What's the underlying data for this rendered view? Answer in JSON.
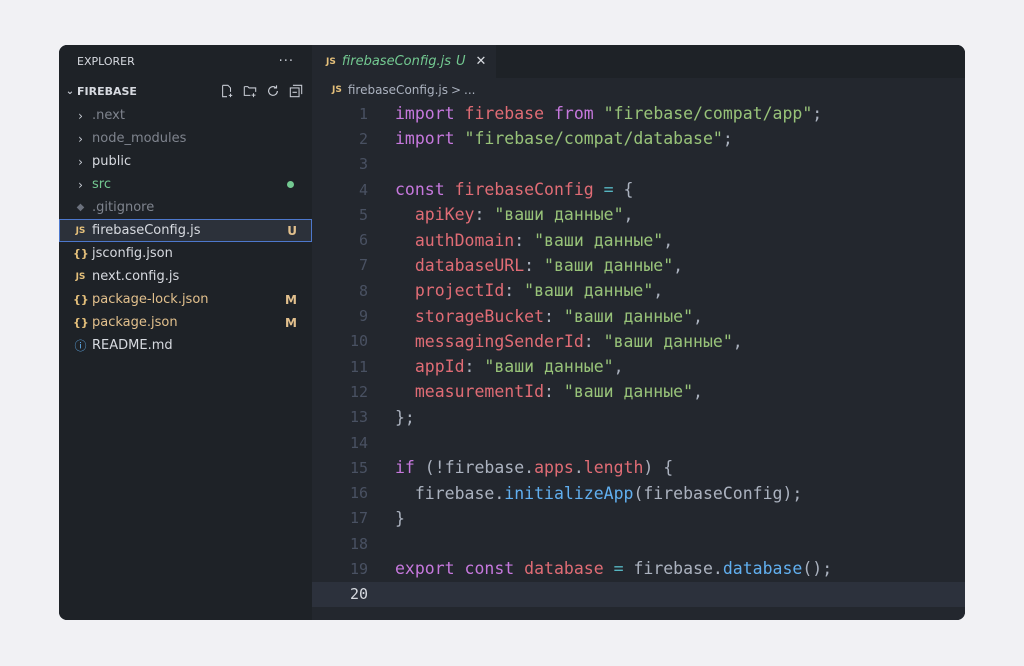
{
  "explorer": {
    "title": "EXPLORER",
    "more": "···",
    "folder": "FIREBASE",
    "items": [
      {
        "label": ".next",
        "kind": "folder",
        "style": "dim"
      },
      {
        "label": "node_modules",
        "kind": "folder",
        "style": "dim"
      },
      {
        "label": "public",
        "kind": "folder",
        "style": "normal"
      },
      {
        "label": "src",
        "kind": "folder",
        "style": "green"
      },
      {
        "label": ".gitignore",
        "kind": "git",
        "style": "dim"
      },
      {
        "label": "firebaseConfig.js",
        "kind": "js",
        "style": "normal",
        "badge": "U"
      },
      {
        "label": "jsconfig.json",
        "kind": "json",
        "style": "normal"
      },
      {
        "label": "next.config.js",
        "kind": "js",
        "style": "normal"
      },
      {
        "label": "package-lock.json",
        "kind": "json",
        "style": "mod",
        "badge": "M"
      },
      {
        "label": "package.json",
        "kind": "json",
        "style": "mod",
        "badge": "M"
      },
      {
        "label": "README.md",
        "kind": "info",
        "style": "normal"
      }
    ]
  },
  "tab": {
    "icon": "JS",
    "name": "firebaseConfig.js",
    "status": "U",
    "close": "✕"
  },
  "breadcrumb": {
    "icon": "JS",
    "file": "firebaseConfig.js",
    "sep": ">",
    "rest": "..."
  },
  "code": {
    "active_line": 20,
    "lines": [
      [
        [
          "k",
          "import"
        ],
        [
          "p",
          " "
        ],
        [
          "v",
          "firebase"
        ],
        [
          "p",
          " "
        ],
        [
          "k",
          "from"
        ],
        [
          "p",
          " "
        ],
        [
          "s",
          "\"firebase/compat/app\""
        ],
        [
          "p",
          ";"
        ]
      ],
      [
        [
          "k",
          "import"
        ],
        [
          "p",
          " "
        ],
        [
          "s",
          "\"firebase/compat/database\""
        ],
        [
          "p",
          ";"
        ]
      ],
      [],
      [
        [
          "k",
          "const"
        ],
        [
          "p",
          " "
        ],
        [
          "v",
          "firebaseConfig"
        ],
        [
          "p",
          " "
        ],
        [
          "o",
          "="
        ],
        [
          "p",
          " {"
        ]
      ],
      [
        [
          "p",
          "  "
        ],
        [
          "v",
          "apiKey"
        ],
        [
          "p",
          ": "
        ],
        [
          "s",
          "\"ваши данные\""
        ],
        [
          "p",
          ","
        ]
      ],
      [
        [
          "p",
          "  "
        ],
        [
          "v",
          "authDomain"
        ],
        [
          "p",
          ": "
        ],
        [
          "s",
          "\"ваши данные\""
        ],
        [
          "p",
          ","
        ]
      ],
      [
        [
          "p",
          "  "
        ],
        [
          "v",
          "databaseURL"
        ],
        [
          "p",
          ": "
        ],
        [
          "s",
          "\"ваши данные\""
        ],
        [
          "p",
          ","
        ]
      ],
      [
        [
          "p",
          "  "
        ],
        [
          "v",
          "projectId"
        ],
        [
          "p",
          ": "
        ],
        [
          "s",
          "\"ваши данные\""
        ],
        [
          "p",
          ","
        ]
      ],
      [
        [
          "p",
          "  "
        ],
        [
          "v",
          "storageBucket"
        ],
        [
          "p",
          ": "
        ],
        [
          "s",
          "\"ваши данные\""
        ],
        [
          "p",
          ","
        ]
      ],
      [
        [
          "p",
          "  "
        ],
        [
          "v",
          "messagingSenderId"
        ],
        [
          "p",
          ": "
        ],
        [
          "s",
          "\"ваши данные\""
        ],
        [
          "p",
          ","
        ]
      ],
      [
        [
          "p",
          "  "
        ],
        [
          "v",
          "appId"
        ],
        [
          "p",
          ": "
        ],
        [
          "s",
          "\"ваши данные\""
        ],
        [
          "p",
          ","
        ]
      ],
      [
        [
          "p",
          "  "
        ],
        [
          "v",
          "measurementId"
        ],
        [
          "p",
          ": "
        ],
        [
          "s",
          "\"ваши данные\""
        ],
        [
          "p",
          ","
        ]
      ],
      [
        [
          "p",
          "};"
        ]
      ],
      [],
      [
        [
          "k",
          "if"
        ],
        [
          "p",
          " (!"
        ],
        [
          "p",
          "firebase"
        ],
        [
          "p",
          "."
        ],
        [
          "v",
          "apps"
        ],
        [
          "p",
          "."
        ],
        [
          "v",
          "length"
        ],
        [
          "p",
          ") {"
        ]
      ],
      [
        [
          "p",
          "  "
        ],
        [
          "p",
          "firebase"
        ],
        [
          "p",
          "."
        ],
        [
          "f",
          "initializeApp"
        ],
        [
          "p",
          "(firebaseConfig);"
        ]
      ],
      [
        [
          "p",
          "}"
        ]
      ],
      [],
      [
        [
          "k",
          "export"
        ],
        [
          "p",
          " "
        ],
        [
          "k",
          "const"
        ],
        [
          "p",
          " "
        ],
        [
          "v",
          "database"
        ],
        [
          "p",
          " "
        ],
        [
          "o",
          "="
        ],
        [
          "p",
          " firebase."
        ],
        [
          "f",
          "database"
        ],
        [
          "p",
          "();"
        ]
      ],
      []
    ]
  }
}
